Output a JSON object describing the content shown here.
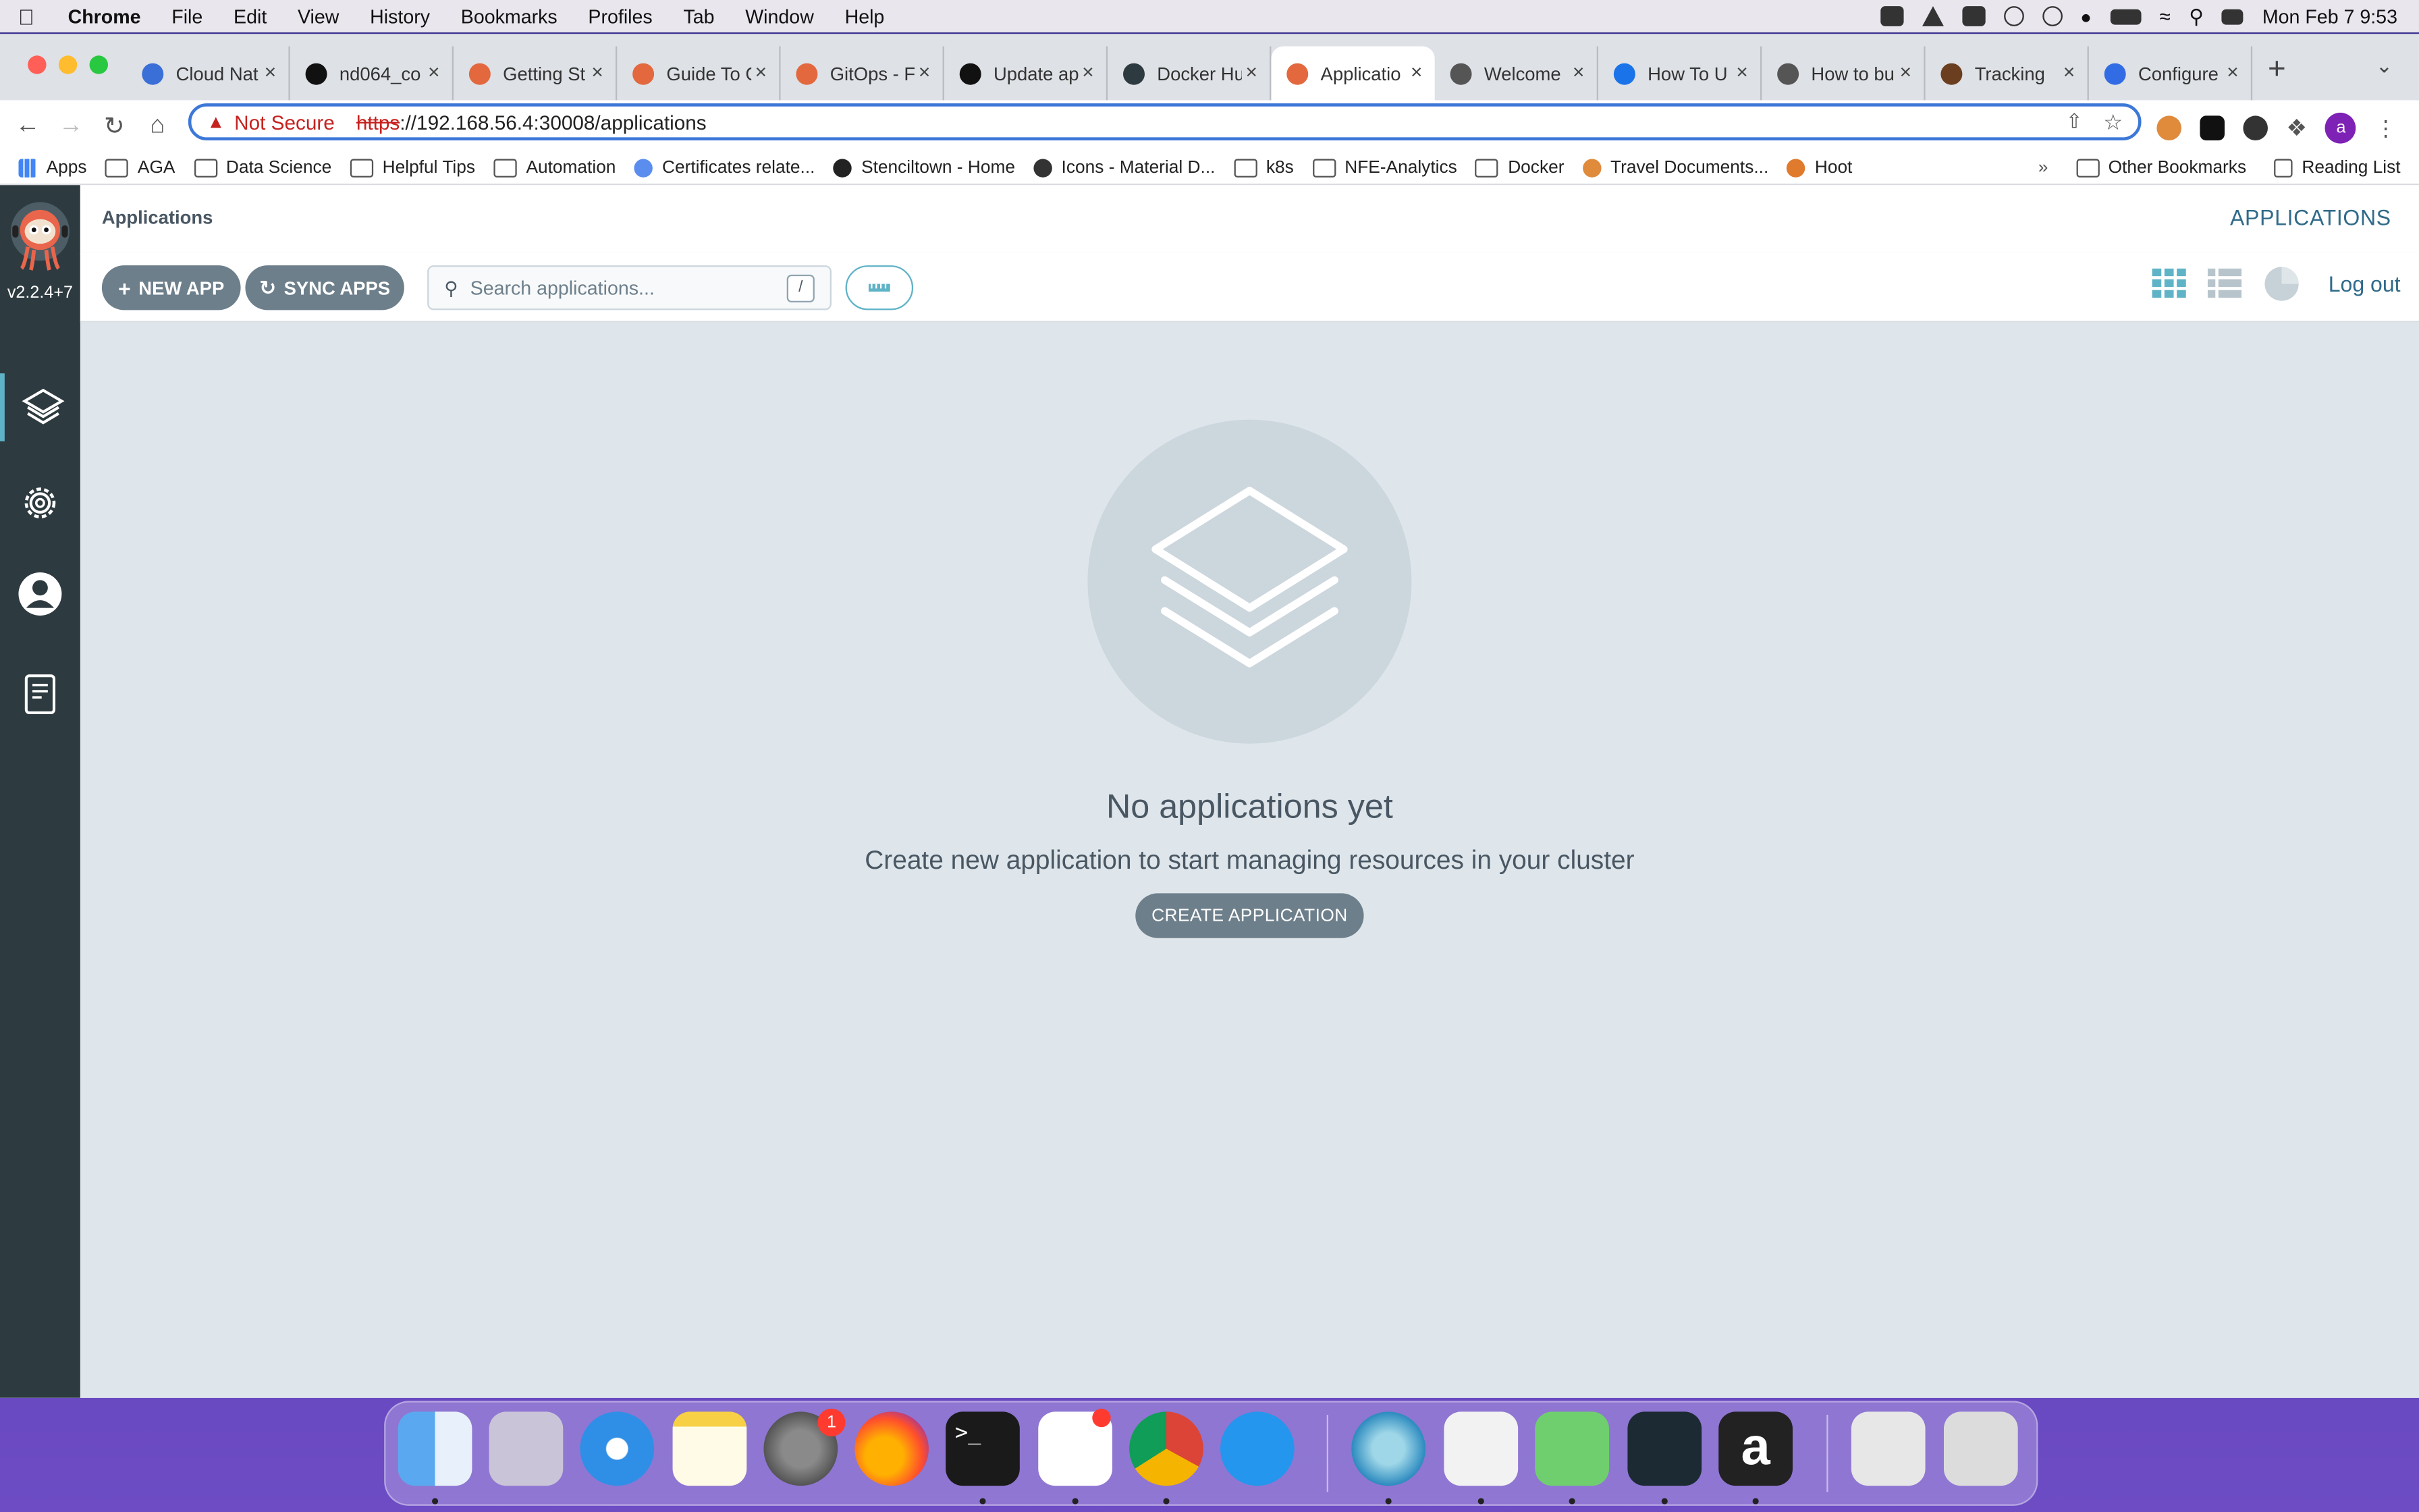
{
  "menubar": {
    "app_name": "Chrome",
    "items": [
      "File",
      "Edit",
      "View",
      "History",
      "Bookmarks",
      "Profiles",
      "Tab",
      "Window",
      "Help"
    ],
    "clock": "Mon Feb 7  9:53"
  },
  "browser": {
    "tabs": [
      {
        "title": "Cloud Nat",
        "color": "#3a6fd8"
      },
      {
        "title": "nd064_co",
        "color": "#111111"
      },
      {
        "title": "Getting St",
        "color": "#e3683d"
      },
      {
        "title": "Guide To G",
        "color": "#e3683d"
      },
      {
        "title": "GitOps - F",
        "color": "#e3683d"
      },
      {
        "title": "Update ap",
        "color": "#111111"
      },
      {
        "title": "Docker Hu",
        "color": "#2d3a40"
      },
      {
        "title": "Applicatio",
        "color": "#e3683d"
      },
      {
        "title": "Welcome",
        "color": "#555555"
      },
      {
        "title": "How To U",
        "color": "#1a73e8"
      },
      {
        "title": "How to bu",
        "color": "#555555"
      },
      {
        "title": "Tracking",
        "color": "#6b3e1f"
      },
      {
        "title": "Configure",
        "color": "#326ce5"
      }
    ],
    "active_tab_index": 7,
    "security_label": "Not Secure",
    "url_scheme": "https",
    "url_rest": "://192.168.56.4:30008/applications",
    "profile_initial": "a"
  },
  "bookmarks": {
    "items": [
      {
        "label": "Apps",
        "kind": "grid"
      },
      {
        "label": "AGA",
        "kind": "folder"
      },
      {
        "label": "Data Science",
        "kind": "folder"
      },
      {
        "label": "Helpful Tips",
        "kind": "folder"
      },
      {
        "label": "Automation",
        "kind": "folder"
      },
      {
        "label": "Certificates relate...",
        "kind": "site"
      },
      {
        "label": "Stenciltown - Home",
        "kind": "site"
      },
      {
        "label": "Icons - Material D...",
        "kind": "site"
      },
      {
        "label": "k8s",
        "kind": "folder"
      },
      {
        "label": "NFE-Analytics",
        "kind": "folder"
      },
      {
        "label": "Docker",
        "kind": "folder"
      },
      {
        "label": "Travel Documents...",
        "kind": "site"
      },
      {
        "label": "Hoot",
        "kind": "site"
      }
    ],
    "other": "Other Bookmarks",
    "reading_list": "Reading List",
    "overflow": "»"
  },
  "argo": {
    "version": "v2.2.4+7",
    "page_title": "Applications",
    "top_right_label": "APPLICATIONS",
    "new_app_label": "NEW APP",
    "sync_apps_label": "SYNC APPS",
    "search_placeholder": "Search applications...",
    "search_shortcut": "/",
    "logout_label": "Log out",
    "empty_title": "No applications yet",
    "empty_subtitle": "Create new application to start managing resources in your cluster",
    "create_label": "CREATE APPLICATION",
    "accent_color": "#306b8a"
  },
  "dock": {
    "settings_badge": "1"
  }
}
